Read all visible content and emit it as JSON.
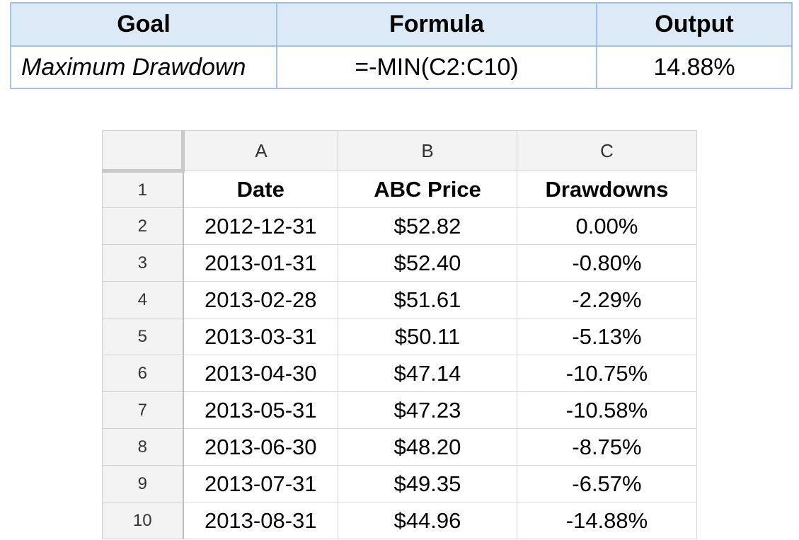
{
  "summary": {
    "headers": {
      "goal": "Goal",
      "formula": "Formula",
      "output": "Output"
    },
    "row": {
      "goal": "Maximum Drawdown",
      "formula": "=-MIN(C2:C10)",
      "output": "14.88%"
    }
  },
  "sheet": {
    "columns": [
      "A",
      "B",
      "C"
    ],
    "header_row": {
      "number": "1",
      "cells": [
        "Date",
        "ABC Price",
        "Drawdowns"
      ]
    },
    "rows": [
      {
        "number": "2",
        "date": "2012-12-31",
        "price": "$52.82",
        "drawdown": "0.00%"
      },
      {
        "number": "3",
        "date": "2013-01-31",
        "price": "$52.40",
        "drawdown": "-0.80%"
      },
      {
        "number": "4",
        "date": "2013-02-28",
        "price": "$51.61",
        "drawdown": "-2.29%"
      },
      {
        "number": "5",
        "date": "2013-03-31",
        "price": "$50.11",
        "drawdown": "-5.13%"
      },
      {
        "number": "6",
        "date": "2013-04-30",
        "price": "$47.14",
        "drawdown": "-10.75%"
      },
      {
        "number": "7",
        "date": "2013-05-31",
        "price": "$47.23",
        "drawdown": "-10.58%"
      },
      {
        "number": "8",
        "date": "2013-06-30",
        "price": "$48.20",
        "drawdown": "-8.75%"
      },
      {
        "number": "9",
        "date": "2013-07-31",
        "price": "$49.35",
        "drawdown": "-6.57%"
      },
      {
        "number": "10",
        "date": "2013-08-31",
        "price": "$44.96",
        "drawdown": "-14.88%"
      }
    ]
  }
}
